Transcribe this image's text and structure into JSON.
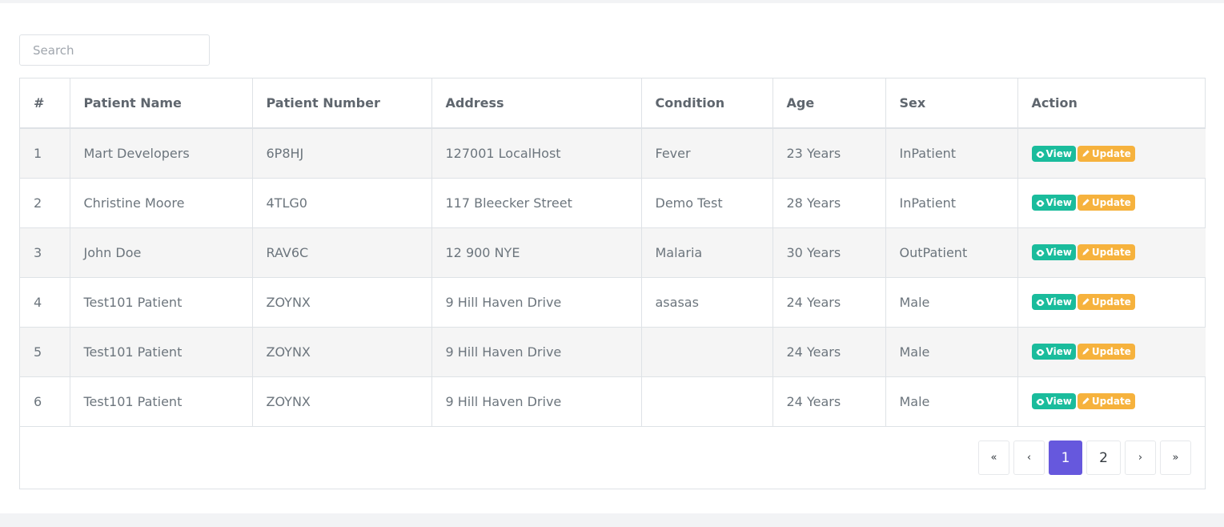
{
  "search": {
    "placeholder": "Search"
  },
  "table": {
    "headers": [
      "#",
      "Patient Name",
      "Patient Number",
      "Address",
      "Condition",
      "Age",
      "Sex",
      "Action"
    ],
    "rows": [
      {
        "num": "1",
        "name": "Mart Developers",
        "number": "6P8HJ",
        "address": "127001 LocalHost",
        "condition": "Fever",
        "age": "23 Years",
        "sex": "InPatient"
      },
      {
        "num": "2",
        "name": "Christine Moore",
        "number": "4TLG0",
        "address": "117 Bleecker Street",
        "condition": "Demo Test",
        "age": "28 Years",
        "sex": "InPatient"
      },
      {
        "num": "3",
        "name": "John Doe",
        "number": "RAV6C",
        "address": "12 900 NYE",
        "condition": "Malaria",
        "age": "30 Years",
        "sex": "OutPatient"
      },
      {
        "num": "4",
        "name": "Test101 Patient",
        "number": "ZOYNX",
        "address": "9 Hill Haven Drive",
        "condition": "asasas",
        "age": "24 Years",
        "sex": "Male"
      },
      {
        "num": "5",
        "name": "Test101 Patient",
        "number": "ZOYNX",
        "address": "9 Hill Haven Drive",
        "condition": "",
        "age": "24 Years",
        "sex": "Male"
      },
      {
        "num": "6",
        "name": "Test101 Patient",
        "number": "ZOYNX",
        "address": "9 Hill Haven Drive",
        "condition": "",
        "age": "24 Years",
        "sex": "Male"
      }
    ],
    "actions": {
      "view": "View",
      "update": "Update",
      "view_icon": "eye-icon",
      "update_icon": "pencil-icon"
    }
  },
  "pagination": {
    "first": "«",
    "prev": "‹",
    "pages": [
      "1",
      "2"
    ],
    "active_page": "1",
    "next": "›",
    "last": "»"
  },
  "colors": {
    "view_badge": "#1abc9c",
    "update_badge": "#f6b23d",
    "active_page": "#6658dd"
  }
}
